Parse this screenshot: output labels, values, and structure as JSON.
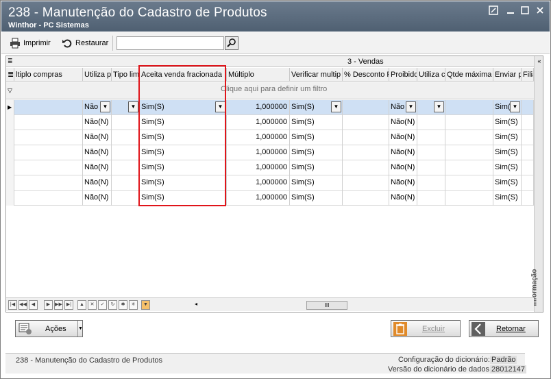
{
  "window": {
    "title": "238 - Manutenção do Cadastro de Produtos",
    "subtitle": "Winthor - PC Sistemas"
  },
  "toolbar": {
    "print_label": "Imprimir",
    "restore_label": "Restaurar",
    "search_value": ""
  },
  "grid": {
    "band_label": "3 - Vendas",
    "filter_hint": "Clique aqui para definir um filtro",
    "columns": [
      "ltiplo compras",
      "Utiliza p",
      "Tipo limi",
      "Aceita venda fracionada",
      "Múltiplo",
      "Verificar multip",
      "% Desconto P",
      "Proibido",
      "Utiliza c",
      "Qtde máxima",
      "Enviar p",
      "Filia"
    ],
    "rows": [
      {
        "utiliza": "Não",
        "aceita": "Sim(S)",
        "multiplo": "1,000000",
        "verificar": "Sim(S)",
        "proibido": "Não",
        "enviar": "Sim("
      },
      {
        "utiliza": "Não(N)",
        "aceita": "Sim(S)",
        "multiplo": "1,000000",
        "verificar": "Sim(S)",
        "proibido": "Não(N)",
        "enviar": "Sim(S)"
      },
      {
        "utiliza": "Não(N)",
        "aceita": "Sim(S)",
        "multiplo": "1,000000",
        "verificar": "Sim(S)",
        "proibido": "Não(N)",
        "enviar": "Sim(S)"
      },
      {
        "utiliza": "Não(N)",
        "aceita": "Sim(S)",
        "multiplo": "1,000000",
        "verificar": "Sim(S)",
        "proibido": "Não(N)",
        "enviar": "Sim(S)"
      },
      {
        "utiliza": "Não(N)",
        "aceita": "Sim(S)",
        "multiplo": "1,000000",
        "verificar": "Sim(S)",
        "proibido": "Não(N)",
        "enviar": "Sim(S)"
      },
      {
        "utiliza": "Não(N)",
        "aceita": "Sim(S)",
        "multiplo": "1,000000",
        "verificar": "Sim(S)",
        "proibido": "Não(N)",
        "enviar": "Sim(S)"
      },
      {
        "utiliza": "Não(N)",
        "aceita": "Sim(S)",
        "multiplo": "1,000000",
        "verificar": "Sim(S)",
        "proibido": "Não(N)",
        "enviar": "Sim(S)"
      }
    ],
    "side_tab": "Informação",
    "hscroll_thumb": "III"
  },
  "footer": {
    "actions_label": "Ações",
    "delete_label": "Excluir",
    "return_label": "Retornar"
  },
  "status": {
    "form_name": "238 - Manutenção do Cadastro de Produtos",
    "dict_config_label": "Configuração do dicionário:",
    "dict_config_value": "Padrão",
    "dict_version_label": "Versão do dicionário de dados:",
    "dict_version_value": "28012147"
  },
  "colors": {
    "titlebar": "#5a6b7d",
    "highlight": "#e0141a",
    "active_row": "#cfe0f4"
  }
}
